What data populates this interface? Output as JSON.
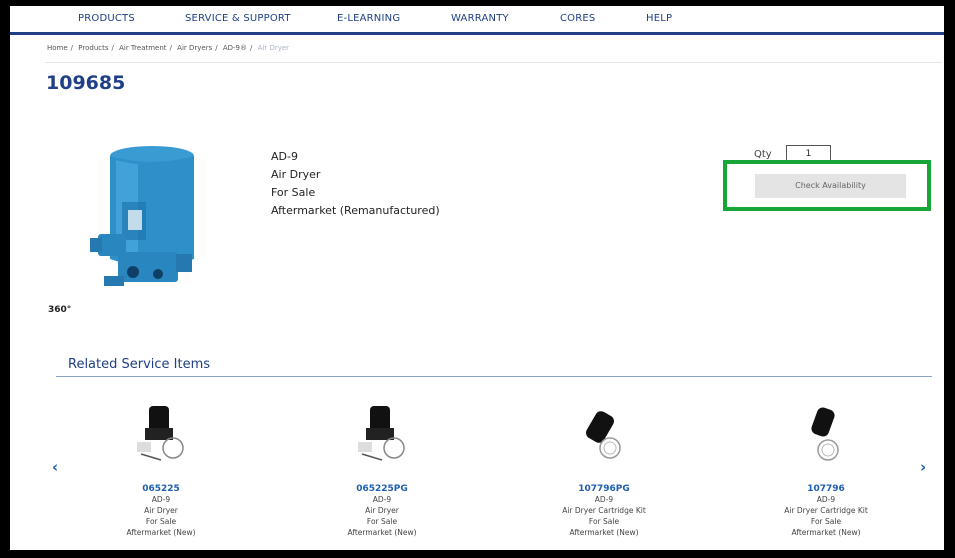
{
  "nav": {
    "items": [
      "PRODUCTS",
      "SERVICE & SUPPORT",
      "E-LEARNING",
      "WARRANTY",
      "CORES",
      "HELP"
    ]
  },
  "breadcrumb": [
    "Home",
    "Products",
    "Air Treatment",
    "Air Dryers",
    "AD-9®",
    "Air Dryer"
  ],
  "product": {
    "sku": "109685",
    "model": "AD-9",
    "name": "Air Dryer",
    "status": "For Sale",
    "type": "Aftermarket (Remanufactured)",
    "icon_360": "360°"
  },
  "purchase": {
    "qty_label": "Qty",
    "qty_value": "1",
    "check_label": "Check Availability"
  },
  "related": {
    "title": "Related Service Items",
    "prev_icon": "‹",
    "next_icon": "›",
    "items": [
      {
        "code": "065225",
        "model": "AD-9",
        "name": "Air Dryer",
        "status": "For Sale",
        "type": "Aftermarket (New)"
      },
      {
        "code": "065225PG",
        "model": "AD-9",
        "name": "Air Dryer",
        "status": "For Sale",
        "type": "Aftermarket (New)"
      },
      {
        "code": "107796PG",
        "model": "AD-9",
        "name": "Air Dryer Cartridge Kit",
        "status": "For Sale",
        "type": "Aftermarket (New)"
      },
      {
        "code": "107796",
        "model": "AD-9",
        "name": "Air Dryer Cartridge Kit",
        "status": "For Sale",
        "type": "Aftermarket (New)"
      }
    ]
  },
  "colors": {
    "brand": "#1f3f86",
    "link": "#1f5fb0",
    "highlight": "#16a638",
    "product_blue": "#2f8fc8"
  }
}
